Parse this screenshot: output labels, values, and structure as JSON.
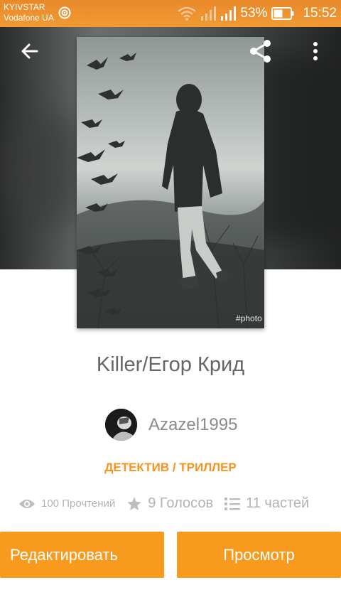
{
  "status_bar": {
    "carrier_primary": "KYIVSTAR",
    "carrier_secondary": "Vodafone UA",
    "battery_percent": "53%",
    "time": "15:52",
    "icons": [
      "nfc-icon",
      "wifi-icon",
      "signal-icon",
      "signal-icon",
      "battery-icon"
    ]
  },
  "toolbar": {
    "back_icon": "arrow-left-icon",
    "share_icon": "share-icon",
    "more_icon": "more-vert-icon"
  },
  "cover": {
    "watermark": "#photo"
  },
  "story": {
    "title": "Killer/Егор Крид",
    "author": "Azazel1995",
    "genre": "ДЕТЕКТИВ / ТРИЛЛЕР"
  },
  "stats": {
    "reads": "100 Прочтений",
    "votes": "9 Голосов",
    "parts": "11 частей"
  },
  "actions": {
    "edit_label": "Редактировать",
    "view_label": "Просмотр"
  },
  "colors": {
    "accent": "#f89a1d",
    "status_bar": "#ee9430",
    "genre_text": "#f7931e",
    "title_text": "#666666"
  }
}
